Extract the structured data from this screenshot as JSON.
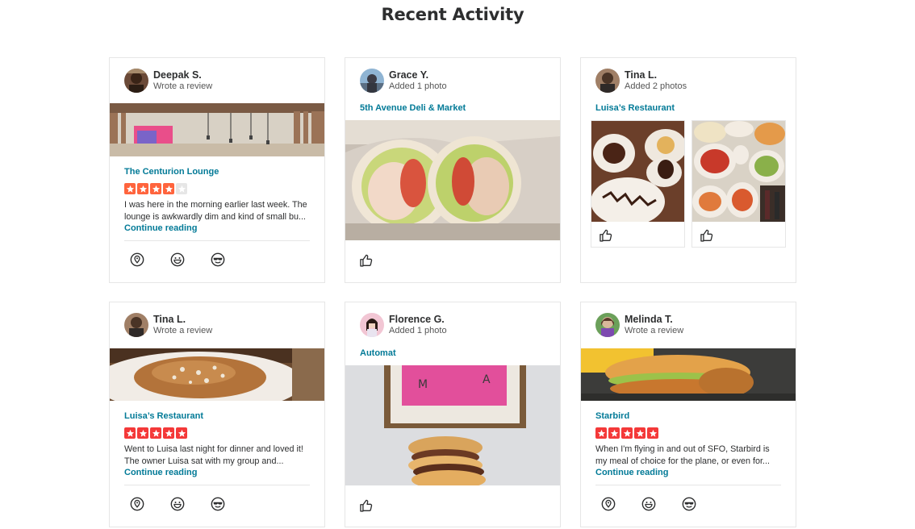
{
  "page": {
    "title": "Recent Activity"
  },
  "colors": {
    "link": "#027a97",
    "star_red": "#f43939",
    "star_orange": "#ff643d",
    "star_empty": "#e6e6e6"
  },
  "cards": [
    {
      "user": "Deepak S.",
      "action": "Wrote a review",
      "business": "The Centurion Lounge",
      "rating": 4,
      "max_rating": 5,
      "snippet": [
        "I was here in the morning earlier last week. The",
        "lounge is awkwardly dim and kind of small bu..."
      ],
      "more": "Continue reading",
      "icons": [
        "pin-icon",
        "smile-icon",
        "cool-face-icon"
      ]
    },
    {
      "user": "Grace Y.",
      "action": "Added 1 photo",
      "business": "5th Avenue Deli & Market",
      "icons": [
        "thumbs-up-icon"
      ]
    },
    {
      "user": "Tina L.",
      "action": "Added 2 photos",
      "business": "Luisa’s Restaurant",
      "icons": [
        "thumbs-up-icon",
        "thumbs-up-icon"
      ]
    },
    {
      "user": "Tina L.",
      "action": "Wrote a review",
      "business": "Luisa’s Restaurant",
      "rating": 5,
      "max_rating": 5,
      "snippet": [
        "Went to Luisa last night for dinner and loved it!",
        "The owner Luisa sat with my group and..."
      ],
      "more": "Continue reading",
      "icons": [
        "pin-icon",
        "smile-icon",
        "cool-face-icon"
      ]
    },
    {
      "user": "Florence G.",
      "action": "Added 1 photo",
      "business": "Automat",
      "icons": [
        "thumbs-up-icon"
      ]
    },
    {
      "user": "Melinda T.",
      "action": "Wrote a review",
      "business": "Starbird",
      "rating": 5,
      "max_rating": 5,
      "snippet": [
        "When I'm flying in and out of SFO, Starbird is",
        "my meal of choice for the plane, or even for..."
      ],
      "more": "Continue reading",
      "icons": [
        "pin-icon",
        "smile-icon",
        "cool-face-icon"
      ]
    }
  ]
}
